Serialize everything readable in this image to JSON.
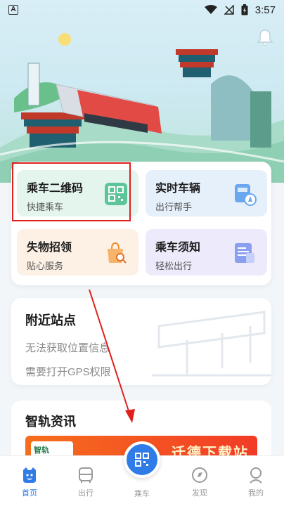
{
  "status_bar": {
    "time": "3:57"
  },
  "services": [
    {
      "title": "乘车二维码",
      "subtitle": "快捷乘车",
      "icon": "qr-code-icon"
    },
    {
      "title": "实时车辆",
      "subtitle": "出行帮手",
      "icon": "realtime-bus-icon"
    },
    {
      "title": "失物招领",
      "subtitle": "贴心服务",
      "icon": "lost-found-bag-icon"
    },
    {
      "title": "乘车须知",
      "subtitle": "轻松出行",
      "icon": "notice-document-icon"
    }
  ],
  "nearby": {
    "title": "附近站点",
    "line1": "无法获取位置信息",
    "line2": "需要打开GPS权限"
  },
  "news": {
    "title": "智轨资讯",
    "banner_logo": "智轨",
    "banner_text": "迁德下载站"
  },
  "tabs": {
    "home": "首页",
    "trip": "出行",
    "ride": "乘车",
    "discover": "发现",
    "mine": "我的"
  },
  "colors": {
    "accent": "#2f7be7",
    "highlight": "#e0201c"
  }
}
